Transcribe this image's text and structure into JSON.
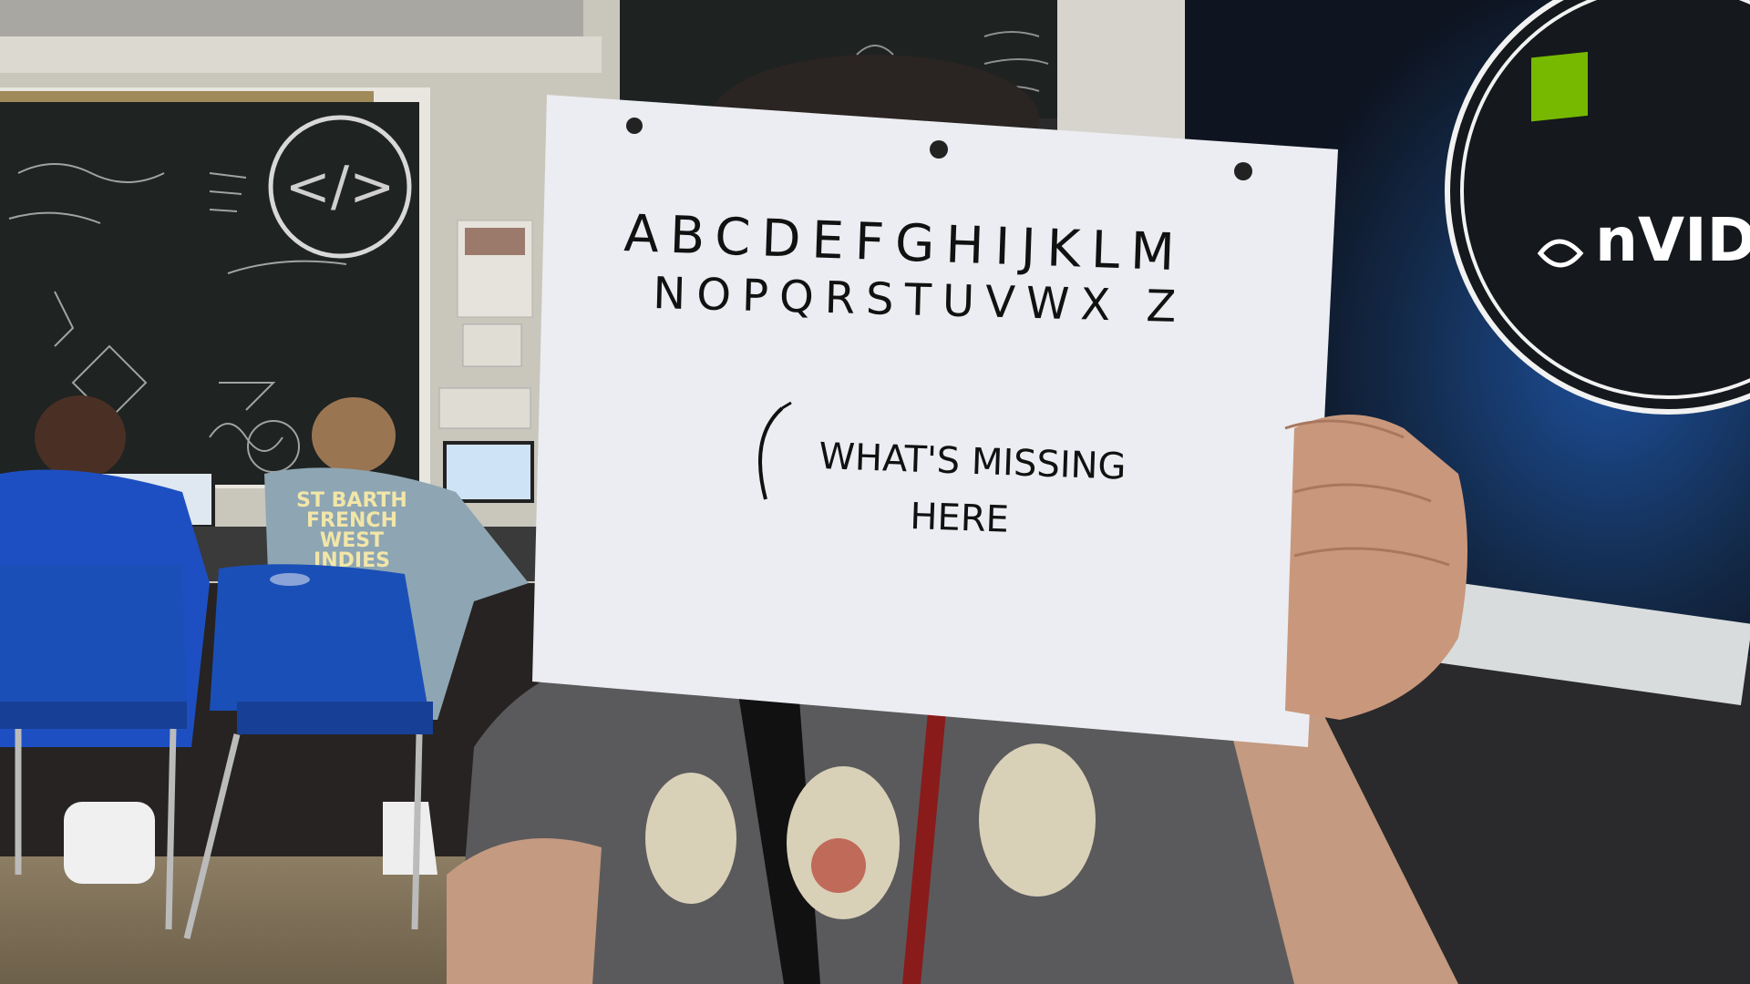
{
  "sign": {
    "alphabet_line1": "ABCDEFGHIJKLM",
    "alphabet_line2": "NOPQRSTUVWX Z",
    "question_line1": "WHAT'S MISSING",
    "question_line2": "HERE"
  },
  "shirt": {
    "line1": "ST BARTH",
    "line2": "FRENCH",
    "line3": "WEST",
    "line4": "INDIES"
  },
  "brand": {
    "logo_text": "nVIDIA",
    "logo_color": "#76b900"
  },
  "colors": {
    "paper": "#ecedf2",
    "chalkboard": "#1f2322",
    "chair_blue": "#1b4fb8",
    "wall": "#c9c6bc"
  }
}
